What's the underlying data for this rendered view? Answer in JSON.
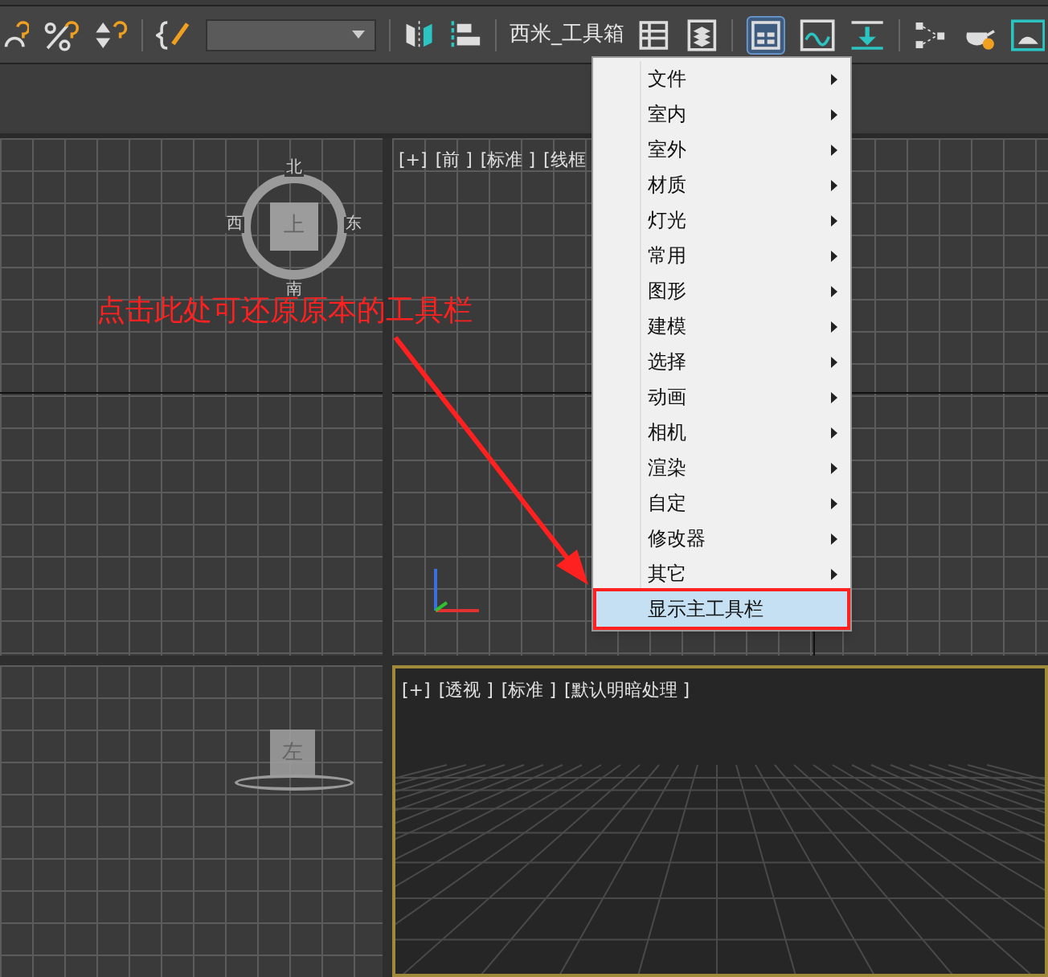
{
  "toolbar": {
    "toolbox_label": "西米_工具箱"
  },
  "viewports": [
    {
      "kind": "top",
      "viewcube": {
        "face": "上",
        "north": "北",
        "west": "西",
        "east": "东",
        "south": "南"
      }
    },
    {
      "kind": "front",
      "labels": [
        "[+]",
        "[前 ]",
        "[标准 ]",
        "[线框"
      ]
    },
    {
      "kind": "left",
      "viewcube": {
        "face": "左"
      }
    },
    {
      "kind": "perspective",
      "selected": true,
      "labels": [
        "[+]",
        "[透视 ]",
        "[标准 ]",
        "[默认明暗处理 ]"
      ]
    }
  ],
  "annotation": {
    "text": "点击此处可还原原本的工具栏"
  },
  "context_menu": {
    "items": [
      {
        "label": "文件",
        "submenu": true,
        "selected": false,
        "outlined": false
      },
      {
        "label": "室内",
        "submenu": true,
        "selected": false,
        "outlined": false
      },
      {
        "label": "室外",
        "submenu": true,
        "selected": false,
        "outlined": false
      },
      {
        "label": "材质",
        "submenu": true,
        "selected": false,
        "outlined": false
      },
      {
        "label": "灯光",
        "submenu": true,
        "selected": false,
        "outlined": false
      },
      {
        "label": "常用",
        "submenu": true,
        "selected": false,
        "outlined": false
      },
      {
        "label": "图形",
        "submenu": true,
        "selected": false,
        "outlined": false
      },
      {
        "label": "建模",
        "submenu": true,
        "selected": false,
        "outlined": false
      },
      {
        "label": "选择",
        "submenu": true,
        "selected": false,
        "outlined": false
      },
      {
        "label": "动画",
        "submenu": true,
        "selected": false,
        "outlined": false
      },
      {
        "label": "相机",
        "submenu": true,
        "selected": false,
        "outlined": false
      },
      {
        "label": "渲染",
        "submenu": true,
        "selected": false,
        "outlined": false
      },
      {
        "label": "自定",
        "submenu": true,
        "selected": false,
        "outlined": false
      },
      {
        "label": "修改器",
        "submenu": true,
        "selected": false,
        "outlined": false
      },
      {
        "label": "其它",
        "submenu": true,
        "selected": false,
        "outlined": false
      },
      {
        "label": "显示主工具栏",
        "submenu": false,
        "selected": true,
        "outlined": true
      }
    ]
  }
}
